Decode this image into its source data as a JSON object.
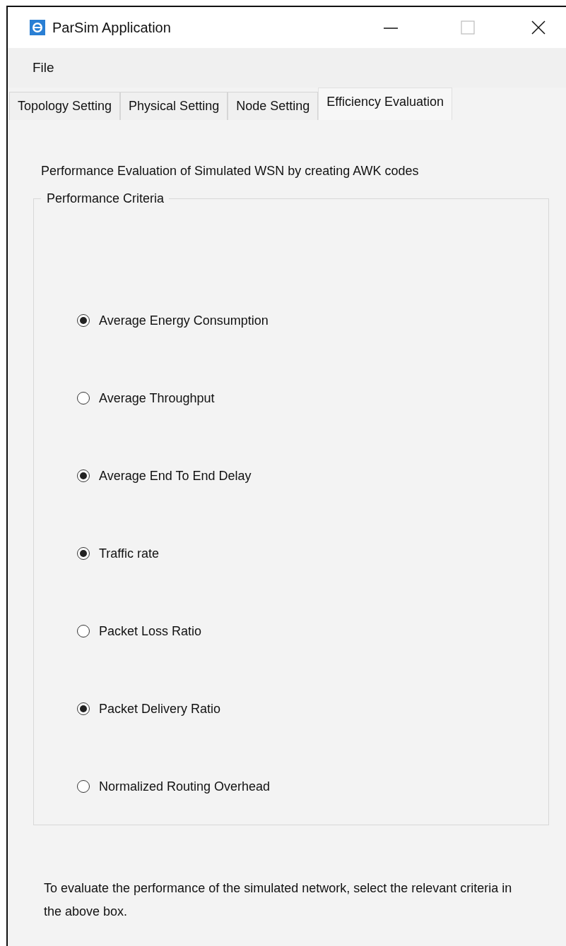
{
  "window": {
    "title": "ParSim Application"
  },
  "menu": [
    "File"
  ],
  "tabs": [
    {
      "label": "Topology Setting",
      "selected": false
    },
    {
      "label": "Physical Setting",
      "selected": false
    },
    {
      "label": "Node Setting",
      "selected": false
    },
    {
      "label": "Efficiency Evaluation",
      "selected": true
    }
  ],
  "description": "Performance Evaluation of Simulated WSN by creating AWK codes",
  "group": {
    "title": "Performance Criteria",
    "options": [
      {
        "label": "Average Energy Consumption",
        "checked": true
      },
      {
        "label": "Average Throughput",
        "checked": false
      },
      {
        "label": "Average End To End Delay",
        "checked": true
      },
      {
        "label": "Traffic rate",
        "checked": true
      },
      {
        "label": "Packet Loss Ratio",
        "checked": false
      },
      {
        "label": "Packet Delivery Ratio",
        "checked": true
      },
      {
        "label": "Normalized Routing Overhead",
        "checked": false
      }
    ]
  },
  "note": "To evaluate the performance of the simulated network, select the relevant criteria in the above box."
}
